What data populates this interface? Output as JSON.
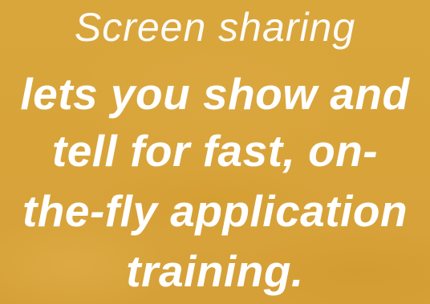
{
  "headline": {
    "intro": "Screen sharing",
    "lines": [
      "lets you show and",
      "tell for fast, on-",
      "the-fly application",
      "training."
    ]
  },
  "colors": {
    "background": "#d8a43a",
    "text": "#ffffff"
  }
}
